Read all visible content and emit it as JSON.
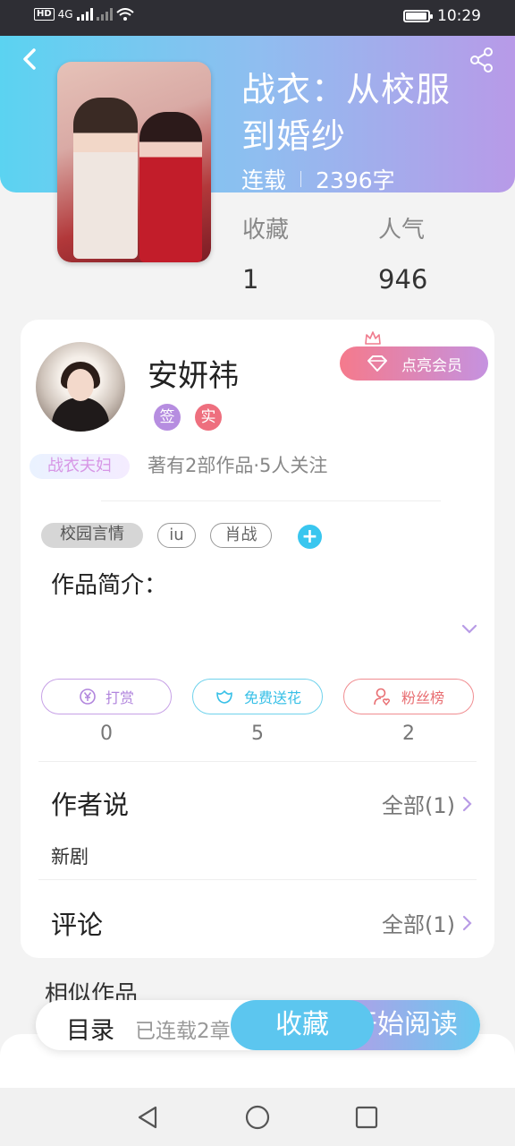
{
  "status_bar": {
    "network": "4G",
    "time": "10:29",
    "battery_level": 0.9
  },
  "book": {
    "title": "战衣：从校服到婚纱",
    "status": "连载",
    "word_count": "2396字",
    "stats": [
      {
        "label": "收藏",
        "value": "1"
      },
      {
        "label": "人气",
        "value": "946"
      }
    ]
  },
  "author": {
    "name": "安妍祎",
    "badges": {
      "sign": "签",
      "real": "实"
    },
    "fan_badge": "战衣夫妇",
    "stats": "著有2部作品·5人关注",
    "vip_button": "点亮会员"
  },
  "tags": {
    "items": [
      "校园言情",
      "iu",
      "肖战"
    ],
    "add": "+"
  },
  "intro": {
    "label": "作品简介："
  },
  "actions": [
    {
      "label": "打赏",
      "count": "0",
      "icon": "yen-coin-icon"
    },
    {
      "label": "免费送花",
      "count": "5",
      "icon": "flower-icon"
    },
    {
      "label": "粉丝榜",
      "count": "2",
      "icon": "fan-user-icon"
    }
  ],
  "author_says": {
    "title": "作者说",
    "link": "全部(1)",
    "content": "新剧"
  },
  "comments": {
    "title": "评论",
    "link": "全部(1)"
  },
  "similar": {
    "title": "相似作品"
  },
  "bottom_bar": {
    "toc": "目录",
    "serial": "已连载2章",
    "favorite": "收藏",
    "read": "开始阅读"
  },
  "colors": {
    "header_gradient": [
      "#5bd3f1",
      "#b89ae8"
    ],
    "accent_blue": "#5cc6ef",
    "accent_purple": "#b89be6",
    "vip_pink": "#f57a8c"
  }
}
